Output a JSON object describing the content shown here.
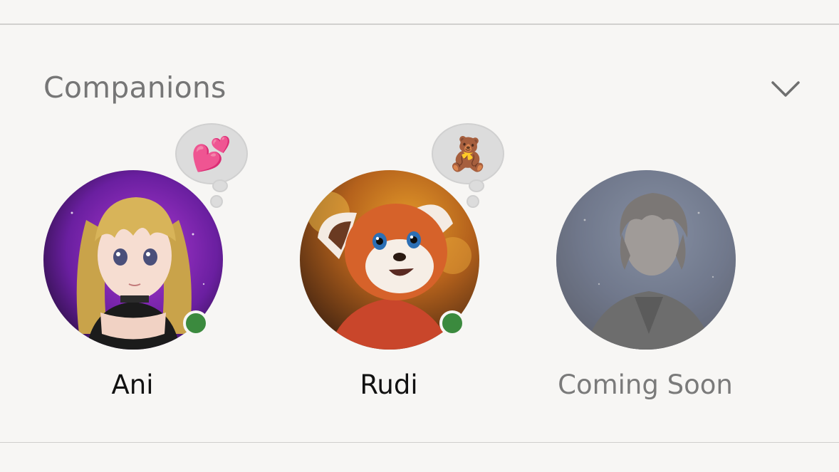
{
  "section": {
    "title": "Companions",
    "collapse_icon": "chevron-down-icon"
  },
  "companions": [
    {
      "name": "Ani",
      "status": "online",
      "bubble_emoji": "💕",
      "status_color": "#3b8a3e"
    },
    {
      "name": "Rudi",
      "status": "online",
      "bubble_emoji": "🧸",
      "status_color": "#3b8a3e"
    },
    {
      "name": "Coming Soon",
      "status": "unavailable"
    }
  ],
  "colors": {
    "background": "#f7f6f4",
    "title": "#767676",
    "name": "#111111",
    "disabled_name": "#7a7a7a"
  }
}
